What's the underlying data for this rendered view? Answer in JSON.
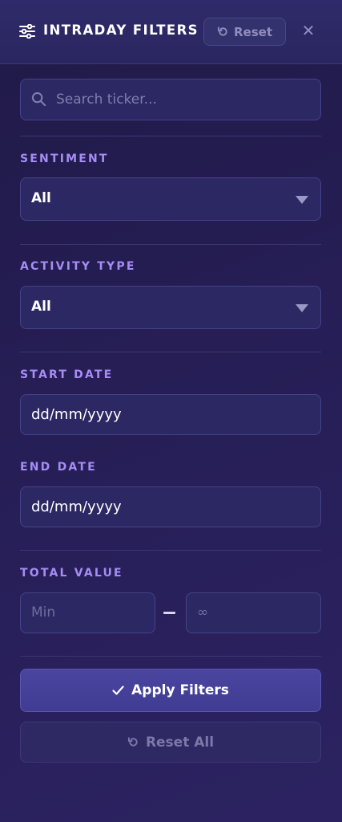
{
  "header": {
    "title": "INTRADAY FILTERS",
    "reset_label": "Reset",
    "close_glyph": "✕",
    "icons": {
      "filter": "sliders-icon",
      "reset": "undo-icon",
      "close": "close-icon"
    }
  },
  "search": {
    "placeholder": "Search ticker...",
    "value": "",
    "icon": "search-icon"
  },
  "sentiment": {
    "label": "SENTIMENT",
    "selected": "All"
  },
  "activity_type": {
    "label": "ACTIVITY TYPE",
    "selected": "All"
  },
  "start_date": {
    "label": "START DATE",
    "value": "dd/mm/yyyy"
  },
  "end_date": {
    "label": "END DATE",
    "value": "dd/mm/yyyy"
  },
  "total_value": {
    "label": "TOTAL VALUE",
    "min_placeholder": "Min",
    "max_placeholder": "∞"
  },
  "actions": {
    "apply_label": "Apply Filters",
    "reset_all_label": "Reset All"
  },
  "colors": {
    "accent_label": "#a68cf5",
    "background": "#251d52",
    "field_bg": "#2c2864",
    "apply_bg": "#4540a0"
  }
}
